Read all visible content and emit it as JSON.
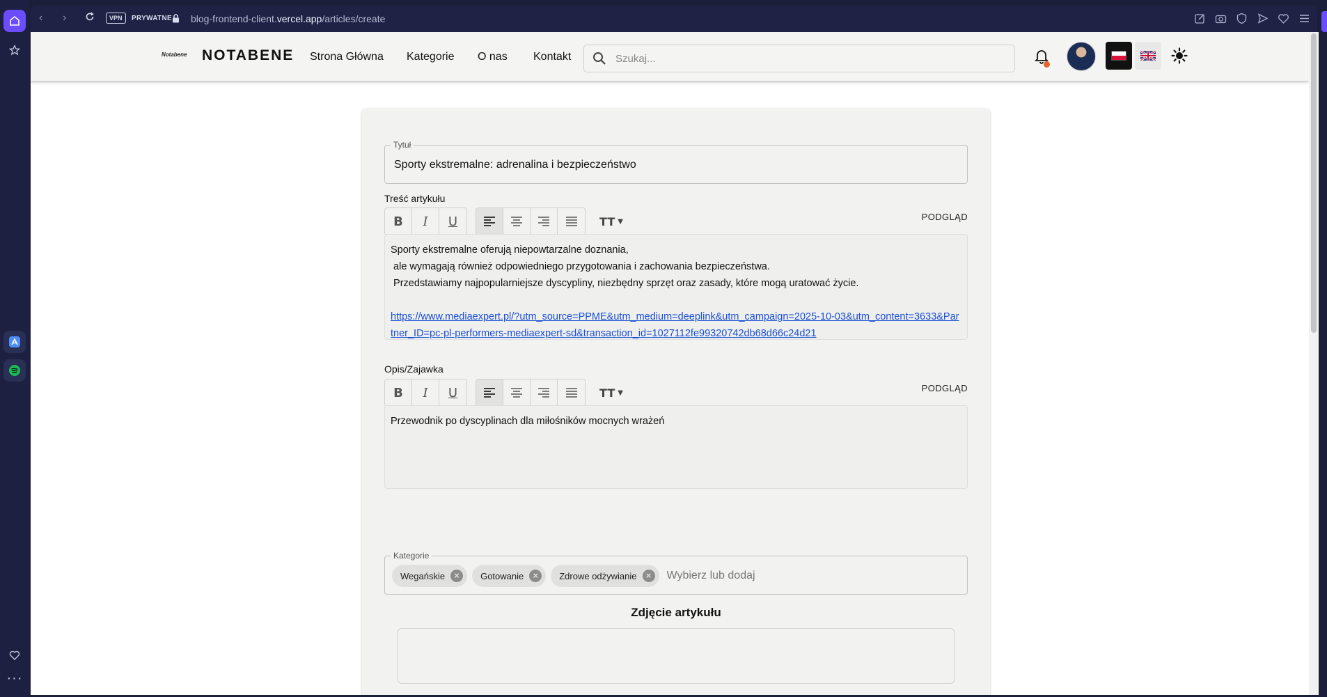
{
  "browser": {
    "vpn_label": "VPN",
    "private_label": "PRYWATNE",
    "url_prefix": "blog-frontend-client.",
    "url_domain": "vercel.app",
    "url_path": "/articles/create"
  },
  "header": {
    "logo_text": "Notabene",
    "brand": "NOTABENE",
    "nav": [
      "Strona Główna",
      "Kategorie",
      "O nas",
      "Kontakt"
    ],
    "search_placeholder": "Szukaj..."
  },
  "form": {
    "title_legend": "Tytuł",
    "title_value": "Sporty ekstremalne: adrenalina i bezpieczeństwo",
    "content_label": "Treść artykułu",
    "preview_label": "PODGLĄD",
    "content_lines": [
      "Sporty ekstremalne oferują niepowtarzalne doznania,",
      " ale wymagają również odpowiedniego przygotowania i zachowania bezpieczeństwa.",
      " Przedstawiamy najpopularniejsze dyscypliny, niezbędny sprzęt oraz zasady, które mogą uratować życie."
    ],
    "content_link": "https://www.mediaexpert.pl/?utm_source=PPME&utm_medium=deeplink&utm_campaign=2025-10-03&utm_content=3633&Partner_ID=pc-pl-performers-mediaexpert-sd&transaction_id=1027112fe99320742db68d66c24d21",
    "excerpt_label": "Opis/Zajawka",
    "excerpt_value": "Przewodnik po dyscyplinach dla miłośników mocnych wrażeń",
    "categories_legend": "Kategorie",
    "categories": [
      "Wegańskie",
      "Gotowanie",
      "Zdrowe odżywianie"
    ],
    "categories_placeholder": "Wybierz lub dodaj",
    "image_title": "Zdjęcie artykułu"
  },
  "toolbar_glyphs": {
    "bold": "B",
    "italic": "I",
    "underline": "U",
    "size": "TT"
  },
  "colors": {
    "accent": "#6a4dff",
    "link": "#1a4fd6",
    "notification_dot": "#e8612c"
  }
}
